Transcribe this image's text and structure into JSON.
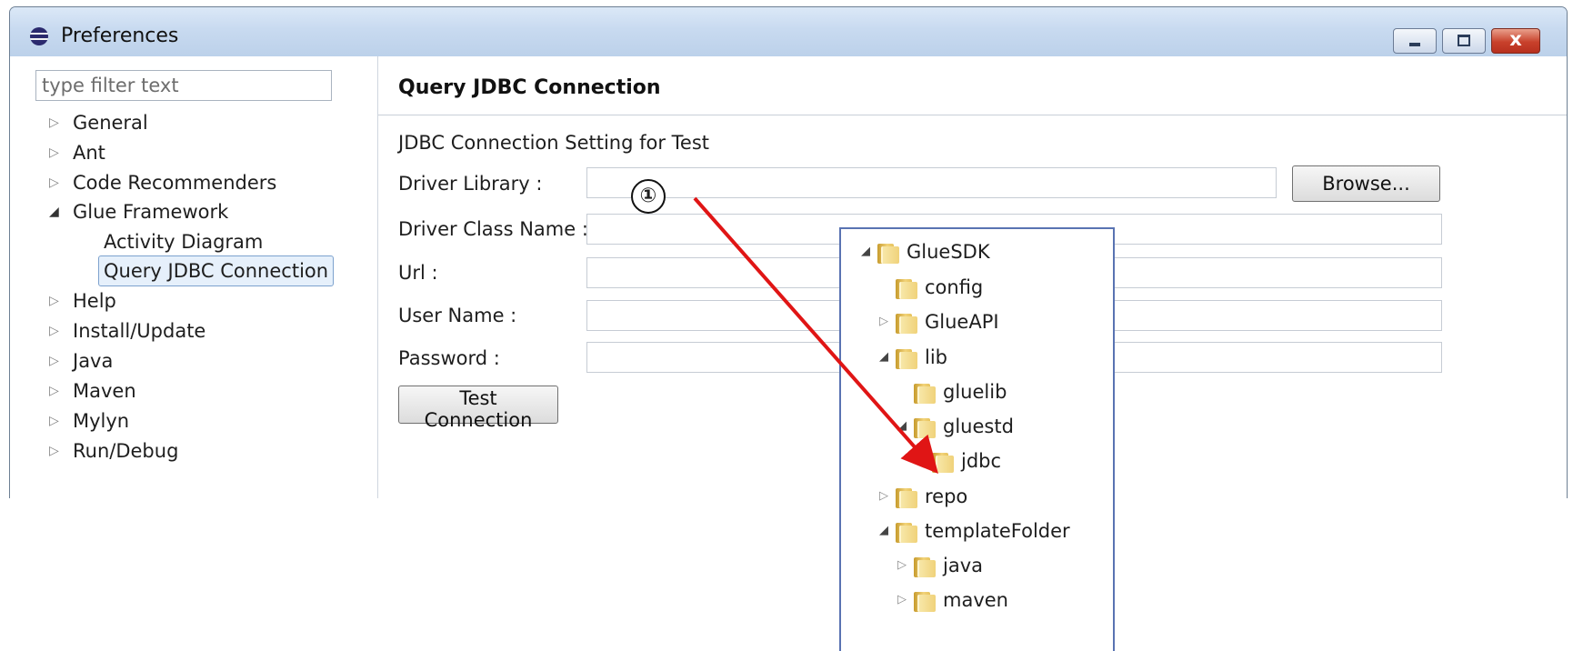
{
  "window": {
    "title": "Preferences",
    "buttons": {
      "minimize": "minimize",
      "maximize": "maximize",
      "close": "x"
    }
  },
  "left": {
    "filter_placeholder": "type filter text",
    "tree": [
      {
        "label": "General",
        "state": "collapsed"
      },
      {
        "label": "Ant",
        "state": "collapsed"
      },
      {
        "label": "Code Recommenders",
        "state": "collapsed"
      },
      {
        "label": "Glue Framework",
        "state": "expanded"
      },
      {
        "label": "Activity Diagram",
        "state": "leaf"
      },
      {
        "label": "Query JDBC Connection",
        "state": "leaf",
        "selected": true
      },
      {
        "label": "Help",
        "state": "collapsed"
      },
      {
        "label": "Install/Update",
        "state": "collapsed"
      },
      {
        "label": "Java",
        "state": "collapsed"
      },
      {
        "label": "Maven",
        "state": "collapsed"
      },
      {
        "label": "Mylyn",
        "state": "collapsed"
      },
      {
        "label": "Run/Debug",
        "state": "collapsed"
      }
    ]
  },
  "page": {
    "title": "Query JDBC Connection",
    "section": "JDBC Connection Setting for Test",
    "labels": {
      "driver_library": "Driver Library :",
      "driver_class": "Driver Class Name :",
      "url": "Url :",
      "user": "User Name :",
      "password": "Password :"
    },
    "values": {
      "driver_library": "",
      "driver_class": "",
      "url": "",
      "user": "",
      "password": ""
    },
    "browse_label": "Browse...",
    "test_connection_label": "Test Connection",
    "icons": {
      "back": "back-arrow-icon",
      "forward": "forward-arrow-icon",
      "menu": "view-menu-icon"
    }
  },
  "popup_tree": [
    {
      "label": "GlueSDK",
      "state": "expanded"
    },
    {
      "label": "config",
      "state": "leaf"
    },
    {
      "label": "GlueAPI",
      "state": "collapsed"
    },
    {
      "label": "lib",
      "state": "expanded"
    },
    {
      "label": "gluelib",
      "state": "leaf"
    },
    {
      "label": "gluestd",
      "state": "expanded"
    },
    {
      "label": "jdbc",
      "state": "leaf"
    },
    {
      "label": "repo",
      "state": "collapsed"
    },
    {
      "label": "templateFolder",
      "state": "expanded"
    },
    {
      "label": "java",
      "state": "collapsed"
    },
    {
      "label": "maven",
      "state": "collapsed"
    }
  ],
  "annotation": {
    "marker": "①",
    "color": "#e01515"
  }
}
